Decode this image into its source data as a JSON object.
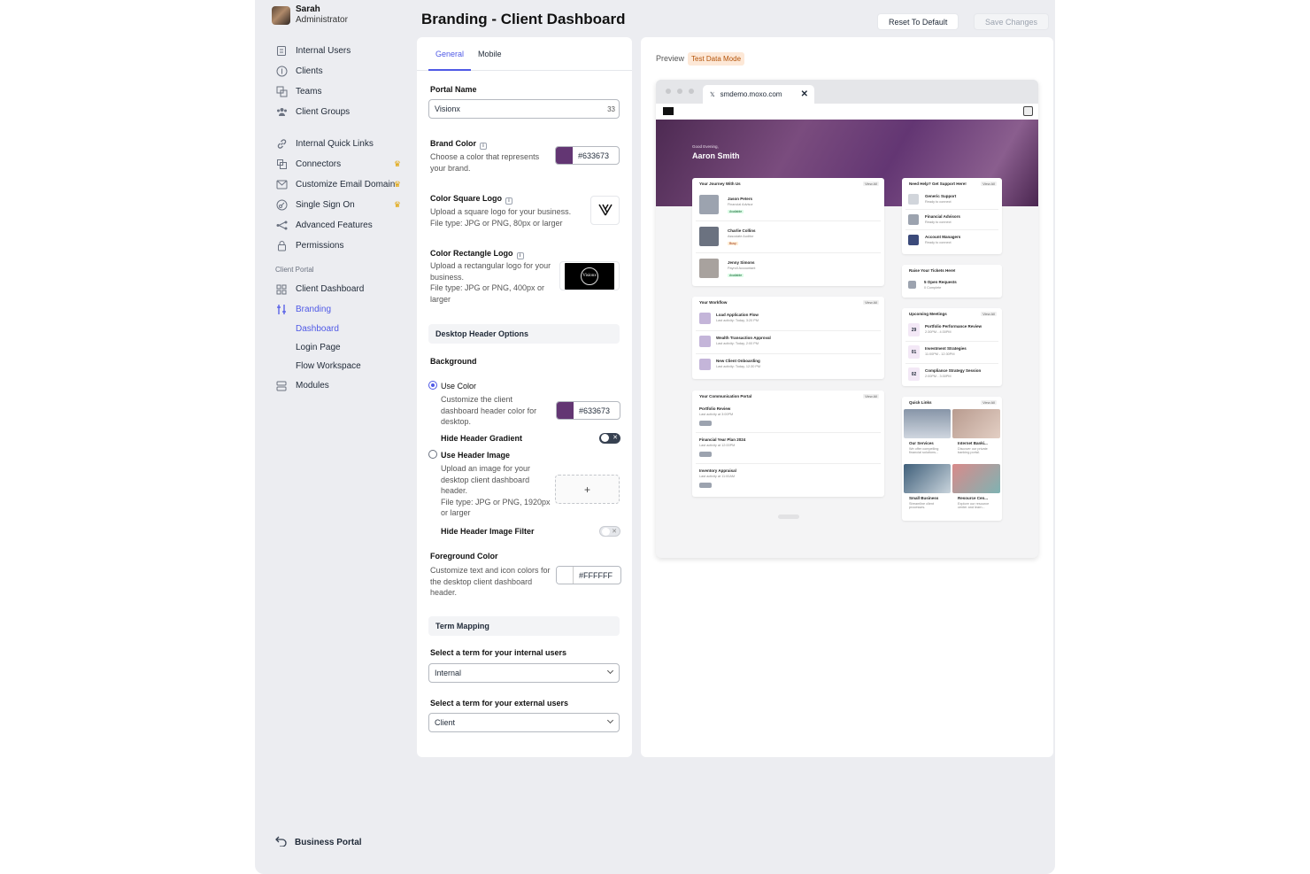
{
  "user": {
    "name": "Sarah",
    "role": "Administrator"
  },
  "nav": {
    "internal_users": "Internal Users",
    "clients": "Clients",
    "teams": "Teams",
    "client_groups": "Client Groups",
    "quick_links": "Internal Quick Links",
    "connectors": "Connectors",
    "email_domain": "Customize Email Domain",
    "sso": "Single Sign On",
    "advanced": "Advanced Features",
    "permissions": "Permissions",
    "section_client_portal": "Client Portal",
    "client_dashboard": "Client Dashboard",
    "branding": "Branding",
    "sub_dashboard": "Dashboard",
    "sub_login": "Login Page",
    "sub_flow": "Flow Workspace",
    "modules": "Modules",
    "business_portal": "Business Portal"
  },
  "header": {
    "title": "Branding - Client Dashboard",
    "reset": "Reset To Default",
    "save": "Save Changes"
  },
  "tabs": {
    "general": "General",
    "mobile": "Mobile"
  },
  "form": {
    "portal_name_label": "Portal Name",
    "portal_name_value": "Visionx",
    "portal_name_count": "33",
    "brand_color_label": "Brand Color",
    "brand_color_desc": "Choose a color that represents your brand.",
    "brand_color_value": "#633673",
    "square_logo_label": "Color Square Logo",
    "square_logo_desc1": "Upload a square logo for your business.",
    "square_logo_desc2": "File type: JPG or PNG, 80px or larger",
    "rect_logo_label": "Color Rectangle Logo",
    "rect_logo_desc1": "Upload a rectangular logo for your business.",
    "rect_logo_desc2": "File type: JPG or PNG, 400px or larger",
    "rect_logo_text": "Visionx",
    "desktop_header": "Desktop Header Options",
    "background_label": "Background",
    "use_color": "Use Color",
    "use_color_desc": "Customize the client dashboard header color for desktop.",
    "header_color_value": "#633673",
    "hide_gradient": "Hide Header Gradient",
    "use_image": "Use Header Image",
    "use_image_desc1": "Upload an image for your desktop client dashboard header.",
    "use_image_desc2": "File type: JPG or PNG, 1920px or larger",
    "upload_plus": "+",
    "hide_filter": "Hide Header Image Filter",
    "fg_label": "Foreground Color",
    "fg_desc": "Customize text and icon colors for the desktop client dashboard header.",
    "fg_value": "#FFFFFF",
    "term_mapping": "Term Mapping",
    "internal_term_label": "Select a term for your internal users",
    "internal_term_value": "Internal",
    "external_term_label": "Select a term for your external users",
    "external_term_value": "Client"
  },
  "preview": {
    "label": "Preview",
    "badge": "Test Data Mode",
    "url": "smdemo.moxo.com",
    "greeting": "Good Evening,",
    "name": "Aaron Smith",
    "journey": {
      "title": "Your Journey With Us",
      "view": "View All",
      "people": [
        {
          "name": "Jason Peters",
          "role": "Financial Advisor",
          "status": "Available"
        },
        {
          "name": "Charlie Collins",
          "role": "Associate Auditor",
          "status": "Busy"
        },
        {
          "name": "Jenny Simons",
          "role": "Payroll Accountant",
          "status": "Available"
        }
      ]
    },
    "workflow": {
      "title": "Your Workflow",
      "view": "View All",
      "items": [
        {
          "name": "Load Application Flow",
          "sub": "Last activity: Today, 3:20 PM"
        },
        {
          "name": "Wealth Transaction Approval",
          "sub": "Last activity: Today, 2:00 PM"
        },
        {
          "name": "New Client Onboarding",
          "sub": "Last activity: Today, 12:30 PM"
        }
      ]
    },
    "comm": {
      "title": "Your Communication Portal",
      "view": "View All",
      "items": [
        {
          "name": "Portfolio Review",
          "sub": "Last activity at 3:00PM"
        },
        {
          "name": "Financial Year Plan 2024",
          "sub": "Last activity at 12:00PM"
        },
        {
          "name": "Inventory Appraisal",
          "sub": "Last activity at 11:00AM"
        }
      ]
    },
    "support": {
      "title": "Need Help? Get Support Here!",
      "view": "View All",
      "items": [
        {
          "name": "Generic Support",
          "sub": "Ready to connect"
        },
        {
          "name": "Financial Advisors",
          "sub": "Ready to connect"
        },
        {
          "name": "Account Managers",
          "sub": "Ready to connect"
        }
      ]
    },
    "tickets": {
      "title": "Raise Your Tickets Here!",
      "name": "5 Open Requests",
      "sub": "0 Complete"
    },
    "meetings": {
      "title": "Upcoming Meetings",
      "view": "View All",
      "items": [
        {
          "day": "29",
          "name": "Portfolio Performance Review",
          "sub": "2:30PM - 4:30PM"
        },
        {
          "day": "01",
          "name": "Investment Strategies",
          "sub": "11:00PM - 12:30PM"
        },
        {
          "day": "02",
          "name": "Compliance Strategy Session",
          "sub": "2:00PM - 3:30PM"
        }
      ]
    },
    "quick": {
      "title": "Quick Links",
      "view": "View All",
      "items": [
        {
          "name": "Our Services",
          "sub": "We offer compelling financial solutions..."
        },
        {
          "name": "Internet Banki...",
          "sub": "Discover our private banking portal."
        },
        {
          "name": "Small Business",
          "sub": "Streamline client processes."
        },
        {
          "name": "Resource Cen...",
          "sub": "Explore our resource center and learn..."
        }
      ]
    }
  }
}
